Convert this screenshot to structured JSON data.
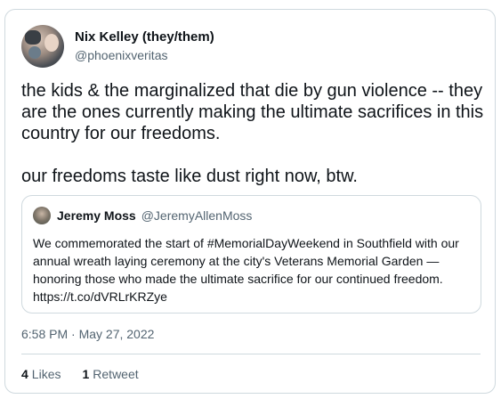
{
  "author": {
    "display_name": "Nix Kelley (they/them)",
    "handle": "@phoenixveritas"
  },
  "tweet": {
    "paragraph_1": "the kids & the marginalized that die by gun violence -- they are the ones currently making the ultimate sacrifices in this country for our freedoms.",
    "paragraph_2": "our freedoms taste like dust right now, btw."
  },
  "quoted_tweet": {
    "display_name": "Jeremy Moss",
    "handle": "@JeremyAllenMoss",
    "text": "We commemorated the start of #MemorialDayWeekend in Southfield with our annual wreath laying ceremony at the city's Veterans Memorial Garden — honoring those who made the ultimate sacrifice for our continued freedom. https://t.co/dVRLrKRZye"
  },
  "timestamp": "6:58 PM · May 27, 2022",
  "stats": {
    "likes_count": "4",
    "likes_label": "Likes",
    "retweets_count": "1",
    "retweets_label": "Retweet"
  }
}
